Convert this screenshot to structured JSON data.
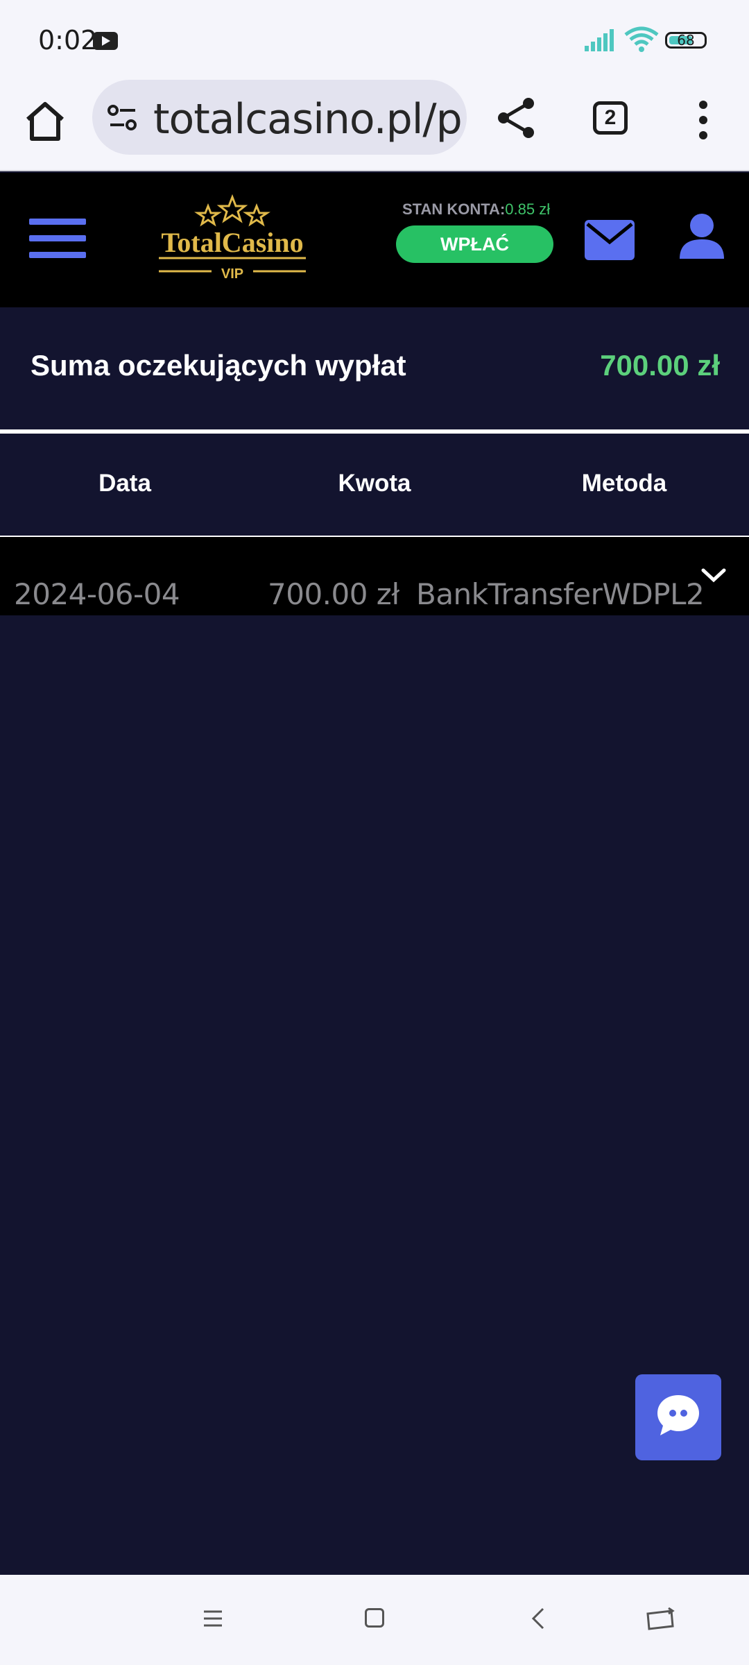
{
  "status_bar": {
    "time": "0:02",
    "battery": "68",
    "icons": [
      "youtube-icon",
      "signal-icon",
      "wifi-icon",
      "battery-icon"
    ]
  },
  "browser": {
    "url": "totalcasino.pl/p",
    "tab_count": "2",
    "icons": [
      "home-icon",
      "site-settings-icon",
      "share-icon",
      "tabs-icon",
      "more-vert-icon"
    ]
  },
  "header": {
    "logo_text": "TotalCasino",
    "logo_sub": "VIP",
    "balance_label": "STAN KONTA:",
    "balance_value": "0.85 zł",
    "deposit_label": "WPŁAĆ",
    "accent_color": "#5a6ff0",
    "deposit_color": "#27c164"
  },
  "summary": {
    "label": "Suma oczekujących wypłat",
    "value": "700.00 zł",
    "value_color": "#5cd07c"
  },
  "table": {
    "columns": [
      "Data",
      "Kwota",
      "Metoda"
    ],
    "rows": [
      {
        "date": "2024-06-04",
        "amount": "700.00 zł",
        "method": "BankTransferWDPL2"
      }
    ]
  },
  "nav": {
    "icons": [
      "recents-icon",
      "home-icon",
      "back-icon",
      "rotate-icon"
    ]
  }
}
